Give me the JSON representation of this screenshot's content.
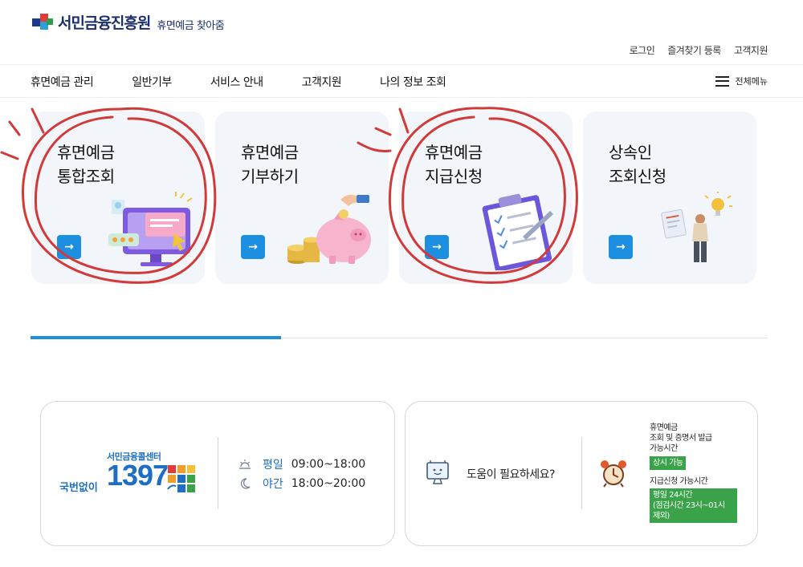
{
  "header": {
    "logo_name": "서민금융진흥원",
    "logo_sub": "휴면예금 찾아줌",
    "util_links": [
      "로그인",
      "즐겨찾기 등록",
      "고객지원"
    ]
  },
  "nav": {
    "items": [
      "휴면예금 관리",
      "일반기부",
      "서비스 안내",
      "고객지원",
      "나의 정보 조회"
    ],
    "all_menu": "전체메뉴"
  },
  "cards": [
    {
      "line1": "휴면예금",
      "line2": "통합조회",
      "icon": "computer-icon"
    },
    {
      "line1": "휴면예금",
      "line2": "기부하기",
      "icon": "piggy-bank-icon"
    },
    {
      "line1": "휴면예금",
      "line2": "지급신청",
      "icon": "clipboard-icon"
    },
    {
      "line1": "상속인",
      "line2": "조회신청",
      "icon": "person-icon"
    }
  ],
  "card_button_symbol": "→",
  "slider": {
    "progress": 0.34
  },
  "callcenter": {
    "name": "서민금융콜센터",
    "prefix": "국번없이",
    "number": "1397",
    "weekday_label": "평일",
    "weekday_hours": "09:00~18:00",
    "night_label": "야간",
    "night_hours": "18:00~20:00"
  },
  "help": {
    "text": "도움이 필요하세요?",
    "inquiry_line1": "휴면예금",
    "inquiry_line2": "조회 및 증명서 발급",
    "inquiry_line3": "가능시간",
    "inquiry_badge": "상시 가능",
    "apply_label": "지급신청 가능시간",
    "apply_badge_line1": "평일 24시간",
    "apply_badge_line2": "(점검시간 23시~01시",
    "apply_badge_line3": "제외)"
  },
  "colors": {
    "accent": "#1d8fe0",
    "brand": "#1b2f6b",
    "green": "#3aa34a",
    "highlight": "#d23a3a"
  }
}
